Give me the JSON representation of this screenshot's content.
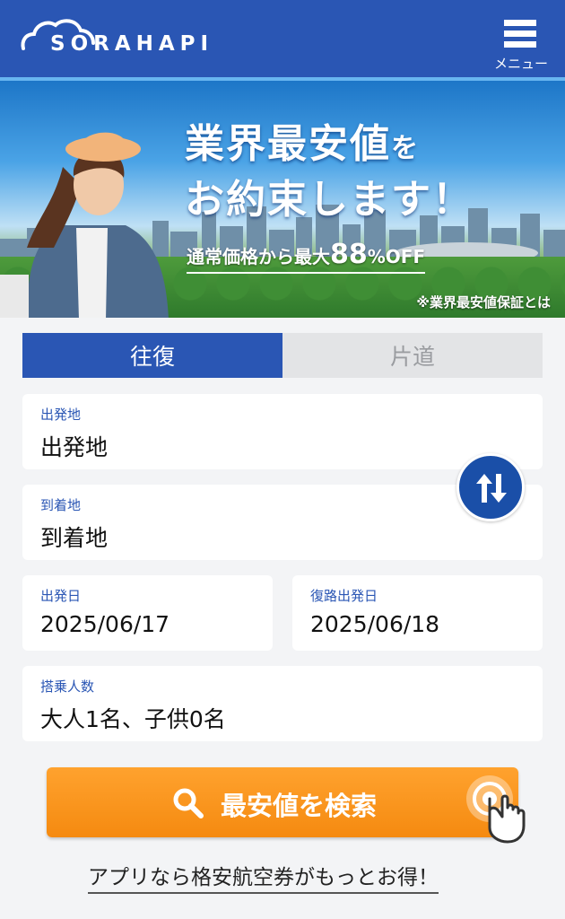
{
  "header": {
    "logo_text": "SORAHAPI",
    "menu_label": "メニュー",
    "bg_color": "#2a56b4"
  },
  "banner": {
    "headline_1": "業界最安値",
    "headline_1_suffix": "を",
    "headline_2": "お約束します！",
    "sub_prefix": "通常価格から最大",
    "sub_value": "88",
    "sub_suffix": "%OFF",
    "note": "※業界最安値保証とは"
  },
  "tabs": [
    {
      "label": "往復",
      "active": true
    },
    {
      "label": "片道",
      "active": false
    }
  ],
  "form": {
    "departure": {
      "label": "出発地",
      "value": "出発地"
    },
    "arrival": {
      "label": "到着地",
      "value": "到着地"
    },
    "depart_date": {
      "label": "出発日",
      "value": "2025/06/17"
    },
    "return_date": {
      "label": "復路出発日",
      "value": "2025/06/18"
    },
    "passengers": {
      "label": "搭乗人数",
      "value": "大人1名、子供0名"
    },
    "swap_icon": "swap-vertical-icon"
  },
  "search": {
    "label": "最安値を検索",
    "icon": "search-icon",
    "color": "#f7931a"
  },
  "app_link": "アプリなら格安航空券がもっとお得！"
}
